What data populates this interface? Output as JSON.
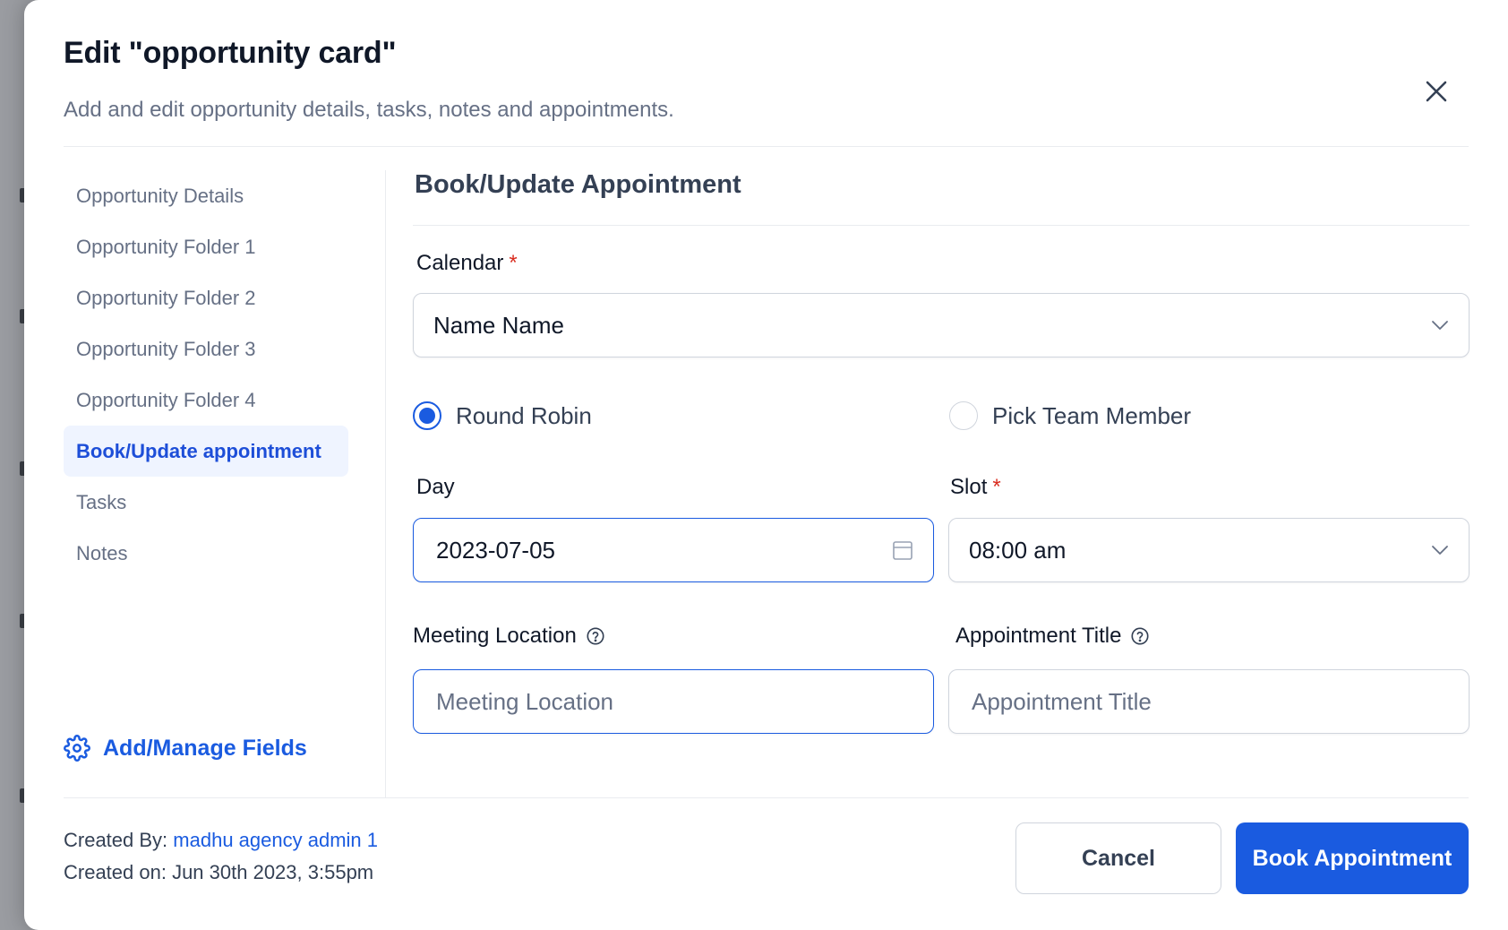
{
  "modal": {
    "title": "Edit \"opportunity card\"",
    "subtitle": "Add and edit opportunity details, tasks, notes and appointments."
  },
  "sidebar": {
    "items": [
      {
        "label": "Opportunity Details"
      },
      {
        "label": "Opportunity Folder 1"
      },
      {
        "label": "Opportunity Folder 2"
      },
      {
        "label": "Opportunity Folder 3"
      },
      {
        "label": "Opportunity Folder 4"
      },
      {
        "label": "Book/Update appointment",
        "active": true
      },
      {
        "label": "Tasks"
      },
      {
        "label": "Notes"
      }
    ],
    "manage_fields_label": "Add/Manage Fields"
  },
  "appointment": {
    "section_title": "Book/Update Appointment",
    "calendar_label": "Calendar",
    "calendar_value": "Name Name",
    "radio_round_robin": "Round Robin",
    "radio_pick_member": "Pick Team Member",
    "selected_assignment": "Round Robin",
    "day_label": "Day",
    "day_value": "2023-07-05",
    "slot_label": "Slot",
    "slot_value": "08:00 am",
    "location_label": "Meeting Location",
    "location_placeholder": "Meeting Location",
    "title_label": "Appointment Title",
    "title_placeholder": "Appointment Title",
    "required_marker": "*"
  },
  "footer": {
    "created_by_label": "Created By:",
    "created_by_value": "madhu agency admin 1",
    "created_on": "Created on: Jun 30th 2023, 3:55pm",
    "cancel_label": "Cancel",
    "book_label": "Book Appointment"
  },
  "colors": {
    "accent": "#1a5be0",
    "active_bg": "#eff4ff",
    "required": "#d92d20"
  }
}
